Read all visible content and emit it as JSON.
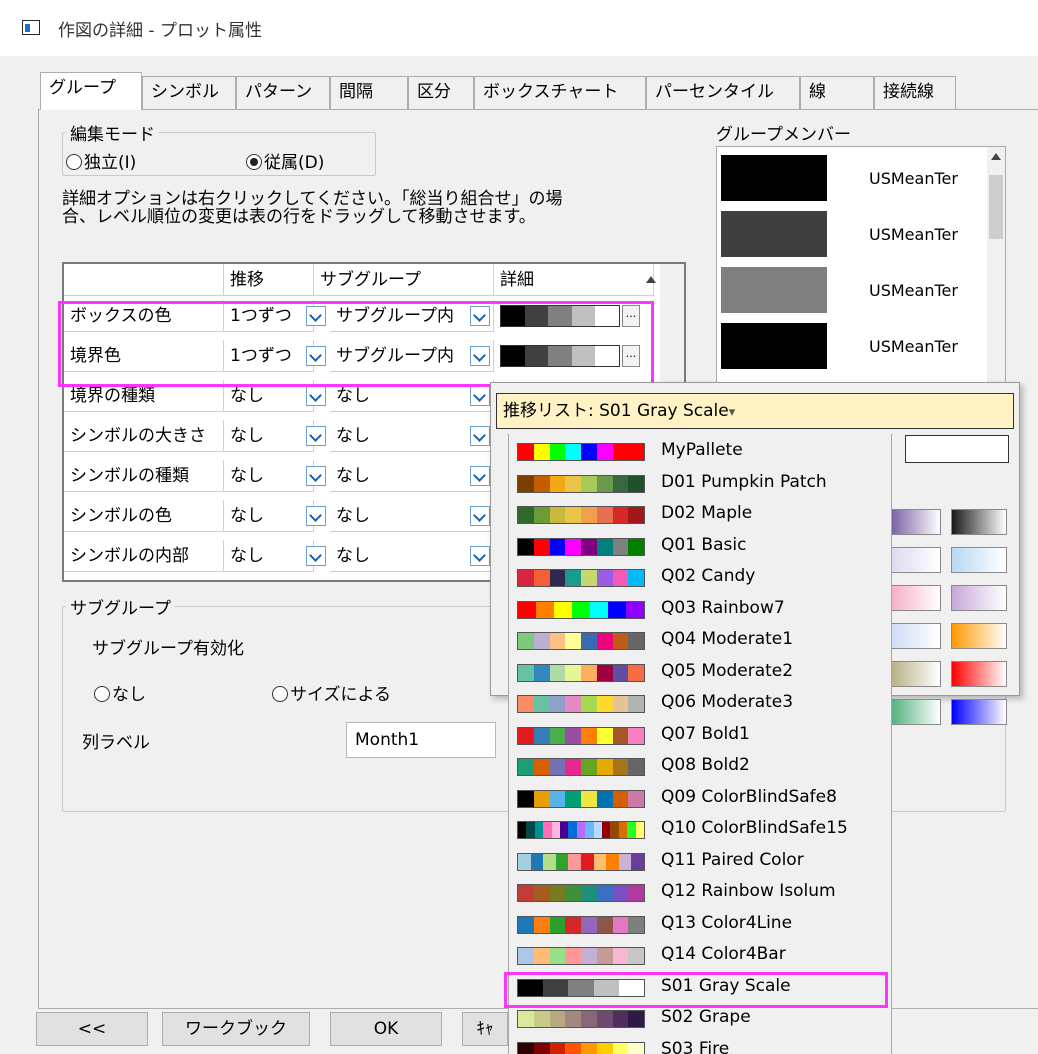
{
  "window": {
    "title": "作図の詳細 - プロット属性"
  },
  "tabs": [
    "グループ",
    "シンボル",
    "パターン",
    "間隔",
    "区分",
    "ボックスチャート",
    "パーセンタイル",
    "線",
    "接続線"
  ],
  "edit_mode": {
    "title": "編集モード",
    "independent": "独立(I)",
    "dependent": "従属(D)"
  },
  "note": "詳細オプションは右クリックしてください。「総当り組合せ」の場合、レベル順位の変更は表の行をドラッグして移動させます。",
  "grid": {
    "headers": [
      "",
      "推移",
      "サブグループ",
      "詳細"
    ],
    "rows": [
      {
        "name": "ボックスの色",
        "step": "1つずつ",
        "subgroup": "サブグループ内"
      },
      {
        "name": "境界色",
        "step": "1つずつ",
        "subgroup": "サブグループ内"
      },
      {
        "name": "境界の種類",
        "step": "なし",
        "subgroup": "なし"
      },
      {
        "name": "シンボルの大きさ",
        "step": "なし",
        "subgroup": "なし"
      },
      {
        "name": "シンボルの種類",
        "step": "なし",
        "subgroup": "なし"
      },
      {
        "name": "シンボルの色",
        "step": "なし",
        "subgroup": "なし"
      },
      {
        "name": "シンボルの内部",
        "step": "なし",
        "subgroup": "なし"
      }
    ]
  },
  "group_members": {
    "title": "グループメンバー",
    "items": [
      {
        "label": "USMeanTer",
        "color": "#000000"
      },
      {
        "label": "USMeanTer",
        "color": "#3f3f3f"
      },
      {
        "label": "USMeanTer",
        "color": "#808080"
      },
      {
        "label": "USMeanTer",
        "color": "#000000"
      }
    ]
  },
  "subgroup": {
    "title": "サブグループ",
    "enable_label": "サブグループ有効化",
    "none": "なし",
    "by_size": "サイズによる",
    "column_label": "列ラベル",
    "column_value": "Month1"
  },
  "popup": {
    "header": "推移リスト: S01 Gray Scale",
    "caret": "▾",
    "palettes": [
      {
        "name": "MyPallete",
        "colors": [
          "#ff0000",
          "#ffff00",
          "#00ff00",
          "#00ffff",
          "#0000ff",
          "#ff00ff",
          "#ff0000",
          "#ff0000"
        ]
      },
      {
        "name": "D01 Pumpkin Patch",
        "colors": [
          "#7b3f00",
          "#c45c00",
          "#f3a712",
          "#e8c547",
          "#a7c957",
          "#6a994e",
          "#386641",
          "#1e5128"
        ]
      },
      {
        "name": "D02 Maple",
        "colors": [
          "#2d6a2d",
          "#6b9b37",
          "#c6b93b",
          "#e8c547",
          "#f29e4c",
          "#e76f51",
          "#d62828",
          "#a4161a"
        ]
      },
      {
        "name": "Q01 Basic",
        "colors": [
          "#000000",
          "#ff0000",
          "#0000ff",
          "#ff00ff",
          "#800080",
          "#008080",
          "#808080",
          "#008000"
        ]
      },
      {
        "name": "Q02 Candy",
        "colors": [
          "#d7263d",
          "#f46036",
          "#2e294e",
          "#1b998b",
          "#c5d86d",
          "#9b5de5",
          "#f15bb5",
          "#00bbf9"
        ]
      },
      {
        "name": "Q03 Rainbow7",
        "colors": [
          "#ff0000",
          "#ff7f00",
          "#ffff00",
          "#00ff00",
          "#00ffff",
          "#0000ff",
          "#8b00ff"
        ]
      },
      {
        "name": "Q04 Moderate1",
        "colors": [
          "#7fc97f",
          "#beaed4",
          "#fdc086",
          "#ffff99",
          "#386cb0",
          "#f0027f",
          "#bf5b17",
          "#666666"
        ]
      },
      {
        "name": "Q05 Moderate2",
        "colors": [
          "#66c2a5",
          "#3288bd",
          "#abdda4",
          "#e6f598",
          "#fdae61",
          "#9e0142",
          "#5e4fa2",
          "#f46d43"
        ]
      },
      {
        "name": "Q06 Moderate3",
        "colors": [
          "#fc8d62",
          "#66c2a5",
          "#8da0cb",
          "#e78ac3",
          "#a6d854",
          "#ffd92f",
          "#e5c494",
          "#b3b3b3"
        ]
      },
      {
        "name": "Q07 Bold1",
        "colors": [
          "#e41a1c",
          "#377eb8",
          "#4daf4a",
          "#984ea3",
          "#ff7f00",
          "#ffff33",
          "#a65628",
          "#f781bf"
        ]
      },
      {
        "name": "Q08 Bold2",
        "colors": [
          "#1b9e77",
          "#d95f02",
          "#7570b3",
          "#e7298a",
          "#66a61e",
          "#e6ab02",
          "#a6761d",
          "#666666"
        ]
      },
      {
        "name": "Q09 ColorBlindSafe8",
        "colors": [
          "#000000",
          "#e69f00",
          "#56b4e9",
          "#009e73",
          "#f0e442",
          "#0072b2",
          "#d55e00",
          "#cc79a7"
        ]
      },
      {
        "name": "Q10 ColorBlindSafe15",
        "colors": [
          "#000000",
          "#004949",
          "#009292",
          "#ff6db6",
          "#ffb6db",
          "#490092",
          "#006ddb",
          "#b66dff",
          "#6db6ff",
          "#b6dbff",
          "#920000",
          "#924900",
          "#db6d00",
          "#24ff24",
          "#ffff6d"
        ]
      },
      {
        "name": "Q11 Paired Color",
        "colors": [
          "#a6cee3",
          "#1f78b4",
          "#b2df8a",
          "#33a02c",
          "#fb9a99",
          "#e31a1c",
          "#fdbf6f",
          "#ff7f00",
          "#cab2d6",
          "#6a3d9a"
        ]
      },
      {
        "name": "Q12 Rainbow Isolum",
        "colors": [
          "#c23b3b",
          "#a65c1f",
          "#7a7a1f",
          "#3f8f3f",
          "#1f8f7a",
          "#3b6fc2",
          "#7a4fc2",
          "#b03b9e"
        ]
      },
      {
        "name": "Q13 Color4Line",
        "colors": [
          "#1f77b4",
          "#ff7f0e",
          "#2ca02c",
          "#d62728",
          "#9467bd",
          "#8c564b",
          "#e377c2",
          "#7f7f7f"
        ]
      },
      {
        "name": "Q14 Color4Bar",
        "colors": [
          "#aec7e8",
          "#ffbb78",
          "#98df8a",
          "#ff9896",
          "#c5b0d5",
          "#c49c94",
          "#f7b6d2",
          "#c7c7c7"
        ]
      },
      {
        "name": "S01 Gray Scale",
        "colors": [
          "#000000",
          "#404040",
          "#808080",
          "#c0c0c0",
          "#ffffff"
        ]
      },
      {
        "name": "S02 Grape",
        "colors": [
          "#d8e99a",
          "#c9c98a",
          "#b8a982",
          "#a3887e",
          "#8a6778",
          "#6e4a70",
          "#4f2d5e",
          "#2e1a47"
        ]
      },
      {
        "name": "S03 Fire",
        "colors": [
          "#2a0000",
          "#800000",
          "#cc2200",
          "#ff5500",
          "#ff9900",
          "#ffcc00",
          "#ffff66",
          "#ffffcc"
        ]
      }
    ]
  },
  "detail_strip": [
    "#000000",
    "#404040",
    "#808080",
    "#c0c0c0",
    "#ffffff"
  ],
  "buttons": {
    "back": "<<",
    "workbook": "ワークブック",
    "ok": "OK",
    "cancel": "ｷｬ"
  }
}
